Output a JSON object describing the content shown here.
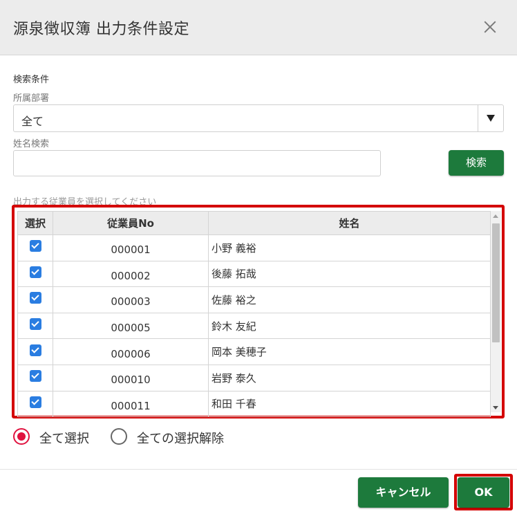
{
  "dialog": {
    "title": "源泉徴収簿 出力条件設定"
  },
  "search": {
    "section_label": "検索条件",
    "department_label": "所属部署",
    "department_value": "全て",
    "name_label": "姓名検索",
    "name_value": "",
    "search_button": "検索"
  },
  "employees": {
    "instruction": "出力する従業員を選択してください",
    "columns": {
      "select": "選択",
      "employee_no": "従業員No",
      "name": "姓名"
    },
    "rows": [
      {
        "selected": true,
        "no": "000001",
        "name": "小野 義裕"
      },
      {
        "selected": true,
        "no": "000002",
        "name": "後藤 拓哉"
      },
      {
        "selected": true,
        "no": "000003",
        "name": "佐藤 裕之"
      },
      {
        "selected": true,
        "no": "000005",
        "name": "鈴木 友紀"
      },
      {
        "selected": true,
        "no": "000006",
        "name": "岡本 美穂子"
      },
      {
        "selected": true,
        "no": "000010",
        "name": "岩野 泰久"
      },
      {
        "selected": true,
        "no": "000011",
        "name": "和田 千春"
      }
    ]
  },
  "selection": {
    "select_all": "全て選択",
    "deselect_all": "全ての選択解除",
    "current": "select_all"
  },
  "footer": {
    "cancel": "キャンセル",
    "ok": "OK"
  },
  "colors": {
    "primary_button": "#1d7a3c",
    "highlight_frame": "#d40000",
    "radio_active": "#e0123f",
    "checkbox": "#2a7de1"
  }
}
